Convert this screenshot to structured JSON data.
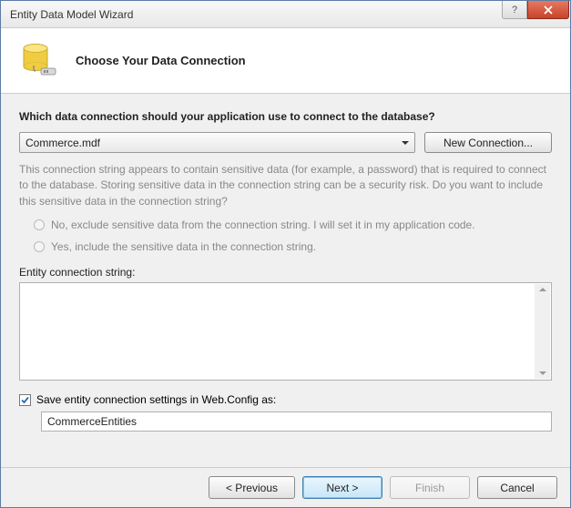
{
  "window": {
    "title": "Entity Data Model Wizard"
  },
  "header": {
    "title": "Choose Your Data Connection"
  },
  "main": {
    "prompt": "Which data connection should your application use to connect to the database?",
    "dropdown_value": "Commerce.mdf",
    "new_connection_label": "New Connection...",
    "info_text": "This connection string appears to contain sensitive data (for example, a password) that is required to connect to the database. Storing sensitive data in the connection string can be a security risk. Do you want to include this sensitive data in the connection string?",
    "radio_exclude": "No, exclude sensitive data from the connection string. I will set it in my application code.",
    "radio_include": "Yes, include the sensitive data in the connection string.",
    "conn_string_label": "Entity connection string:",
    "conn_string_value": "",
    "save_checkbox_label": "Save entity connection settings in Web.Config as:",
    "save_checkbox_checked": true,
    "save_name_value": "CommerceEntities"
  },
  "footer": {
    "previous": "< Previous",
    "next": "Next >",
    "finish": "Finish",
    "cancel": "Cancel"
  }
}
